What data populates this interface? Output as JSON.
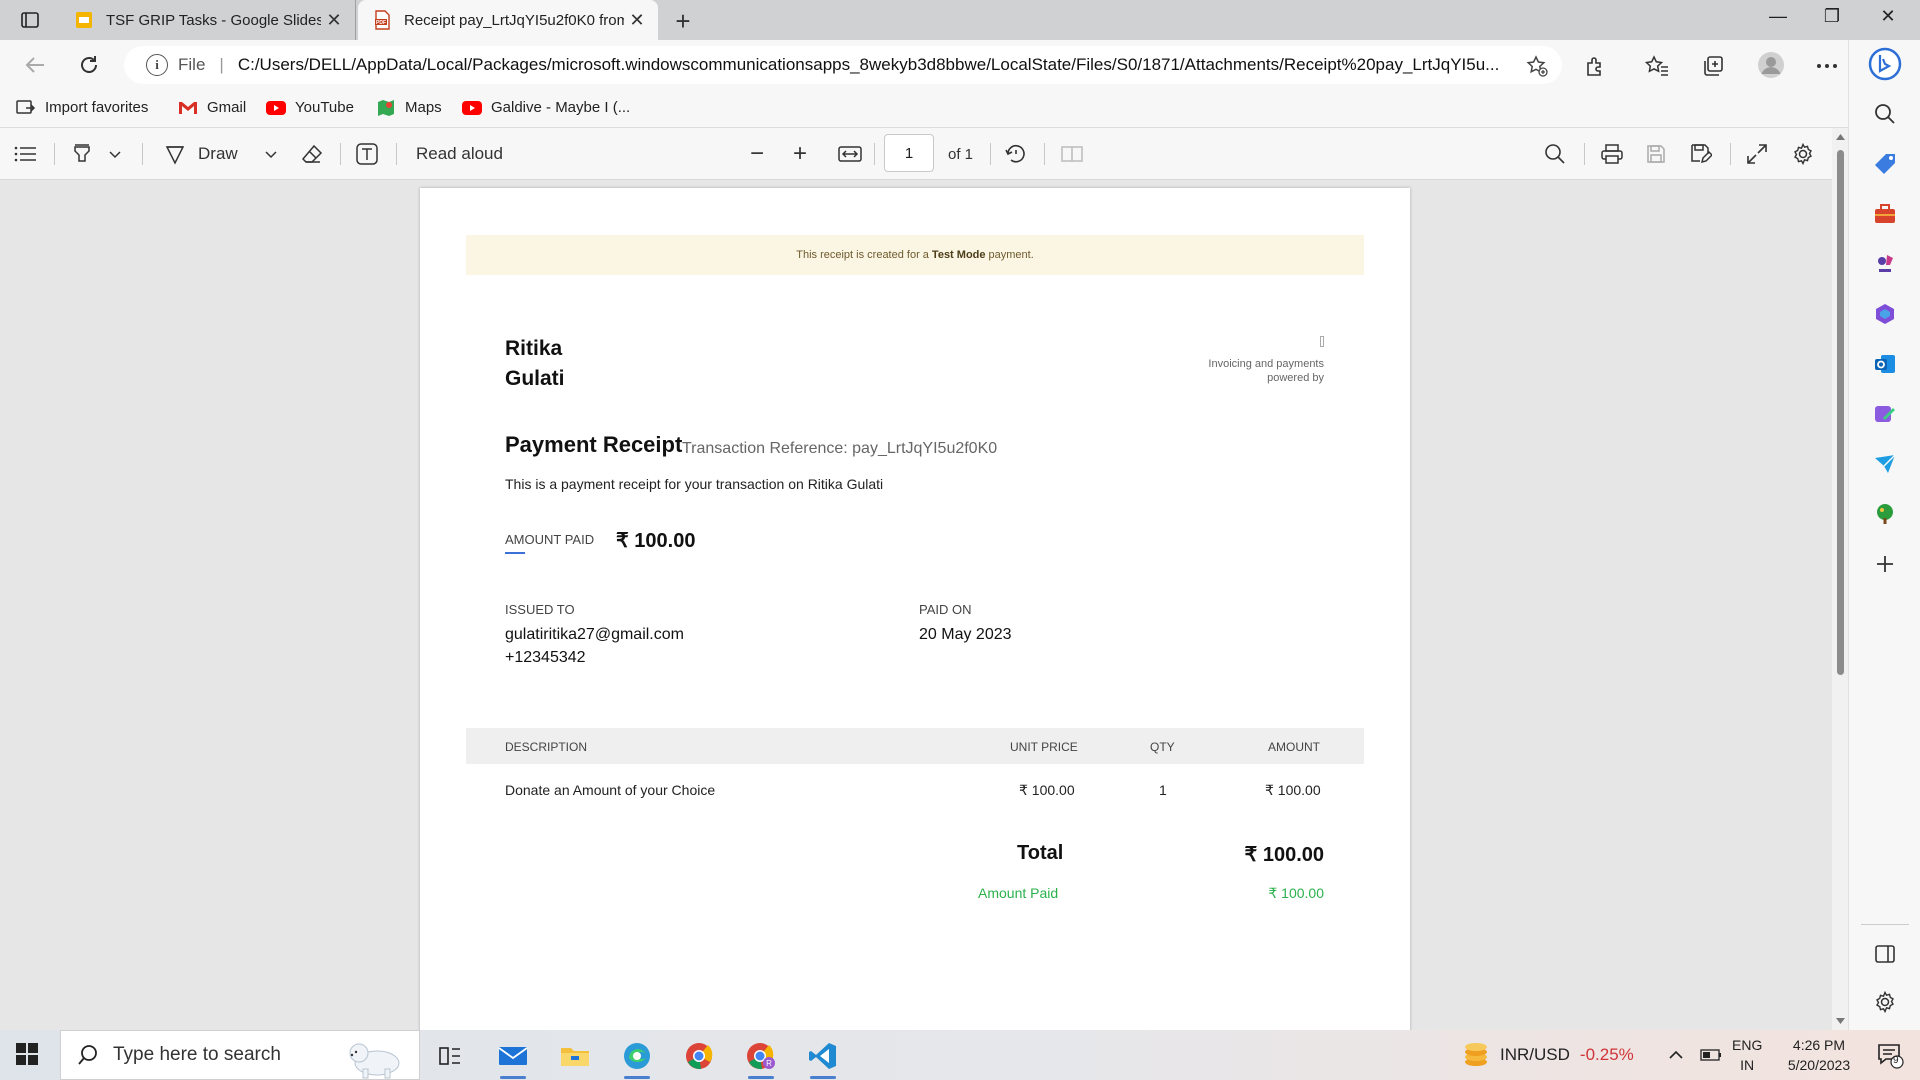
{
  "tabs": [
    {
      "label": "TSF GRIP Tasks - Google Slides",
      "close": "✕",
      "icon": "google-slides-icon"
    },
    {
      "label": "Receipt pay_LrtJqYI5u2f0K0 from",
      "close": "✕",
      "icon": "pdf-icon"
    }
  ],
  "window": {
    "new_tab": "+",
    "minimize": "—",
    "restore": "❐",
    "close": "✕"
  },
  "address": {
    "scheme": "File",
    "url": "C:/Users/DELL/AppData/Local/Packages/microsoft.windowscommunicationsapps_8wekyb3d8bbwe/LocalState/Files/S0/1871/Attachments/Receipt%20pay_LrtJqYI5u..."
  },
  "favorites": [
    {
      "label": "Import favorites",
      "icon": "import-icon"
    },
    {
      "label": "Gmail",
      "icon": "gmail-icon"
    },
    {
      "label": "YouTube",
      "icon": "youtube-icon"
    },
    {
      "label": "Maps",
      "icon": "maps-icon"
    },
    {
      "label": "Galdive - Maybe I (...",
      "icon": "youtube-icon"
    }
  ],
  "pdf_toolbar": {
    "draw_label": "Draw",
    "read_aloud_label": "Read aloud",
    "zoom_out": "−",
    "zoom_in": "+",
    "page_number": "1",
    "page_total": "of 1"
  },
  "receipt": {
    "banner_prefix": "This receipt is created for a",
    "banner_mode": "Test Mode",
    "banner_suffix": "payment.",
    "merchant_line1": "Ritika",
    "merchant_line2": "Gulati",
    "powered_line1": "Invoicing and payments",
    "powered_line2": "powered by",
    "title": "Payment Receipt",
    "transaction_ref": "Transaction Reference: pay_LrtJqYI5u2f0K0",
    "description": "This is a payment receipt for your transaction on Ritika Gulati",
    "amount_paid_label": "AMOUNT PAID",
    "amount_paid_value": "₹ 100.00",
    "issued_to_label": "ISSUED TO",
    "issued_to_email": "gulatiritika27@gmail.com",
    "issued_to_phone": "+12345342",
    "paid_on_label": "PAID ON",
    "paid_on_value": "20 May 2023",
    "table": {
      "headers": [
        "DESCRIPTION",
        "UNIT PRICE",
        "QTY",
        "AMOUNT"
      ],
      "rows": [
        [
          "Donate an Amount of your Choice",
          "₹ 100.00",
          "1",
          "₹ 100.00"
        ]
      ]
    },
    "total_label": "Total",
    "total_value": "₹ 100.00",
    "amount_paid_row_label": "Amount Paid",
    "amount_paid_row_value": "₹ 100.00"
  },
  "taskbar": {
    "search_placeholder": "Type here to search",
    "ticker_label": "INR/USD",
    "ticker_change": "-0.25%",
    "lang_line1": "ENG",
    "lang_line2": "IN",
    "time": "4:26 PM",
    "date": "5/20/2023",
    "notification_count": "9"
  },
  "colors": {
    "accent": "#3c72d8",
    "paid_green": "#2bb24c",
    "ticker_red": "#d13438",
    "banner_bg": "#fbf6e4"
  }
}
